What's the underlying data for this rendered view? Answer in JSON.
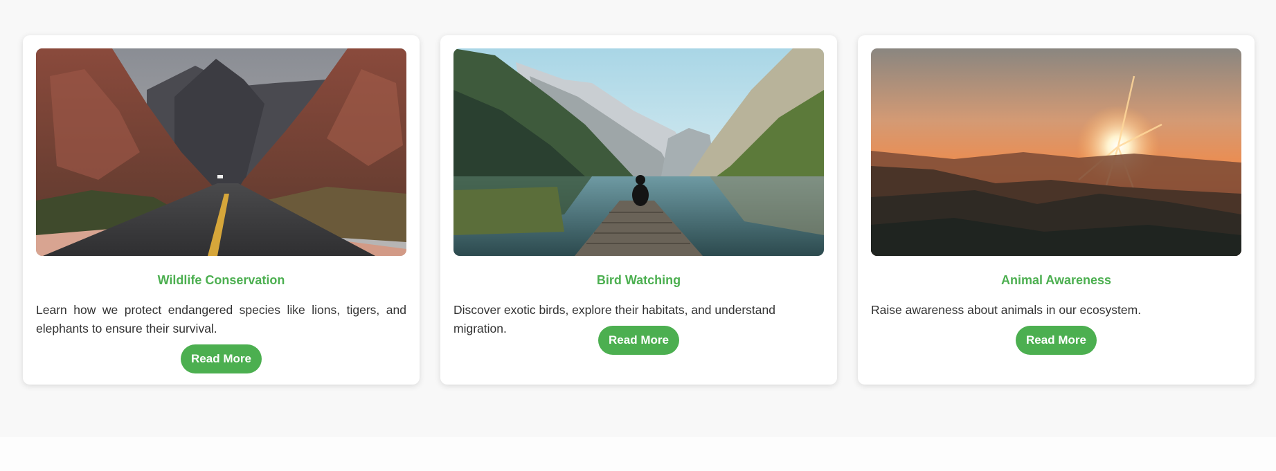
{
  "theme": {
    "accent": "#4caf50"
  },
  "cards": [
    {
      "title": "Wildlife Conservation",
      "description": "Learn how we protect endangered species like lions, tigers, and elephants to ensure their survival.",
      "button_label": "Read More",
      "image": "desert canyon road"
    },
    {
      "title": "Bird Watching",
      "description": "Discover exotic birds, explore their habitats, and understand migration.",
      "button_label": "Read More",
      "image": "person on dock at mountain lake"
    },
    {
      "title": "Animal Awareness",
      "description": "Raise awareness about animals in our ecosystem.",
      "button_label": "Read More",
      "image": "sunset over mountain ridges"
    }
  ]
}
